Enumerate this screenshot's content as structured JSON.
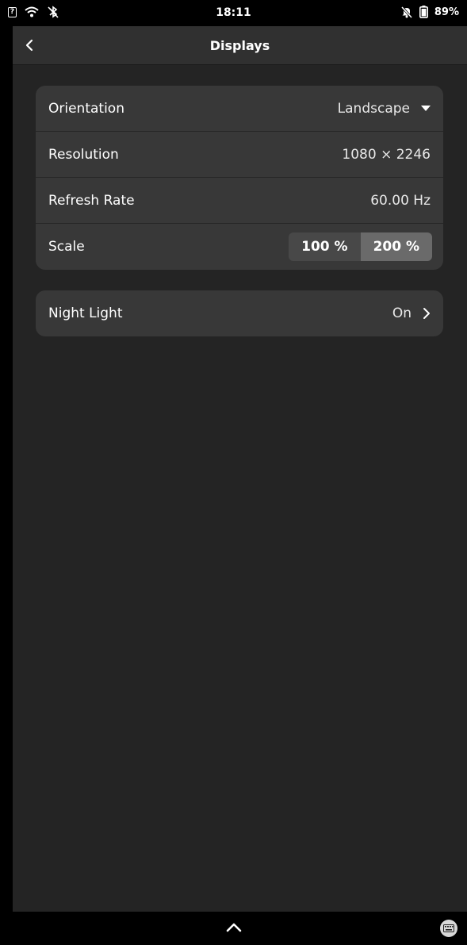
{
  "status_bar": {
    "time": "18:11",
    "battery": "89%",
    "icons": [
      "sim-unknown-icon",
      "wifi-icon",
      "bluetooth-disabled-icon",
      "notifications-muted-icon",
      "battery-icon"
    ]
  },
  "header": {
    "title": "Displays",
    "back_icon": "back-chevron-icon"
  },
  "display_settings": [
    {
      "label": "Orientation",
      "value": "Landscape",
      "control": "dropdown"
    },
    {
      "label": "Resolution",
      "value": "1080 × 2246"
    },
    {
      "label": "Refresh Rate",
      "value": "60.00 Hz"
    },
    {
      "label": "Scale",
      "options": [
        "100 %",
        "200 %"
      ],
      "selected": "200 %"
    }
  ],
  "night_light": {
    "label": "Night Light",
    "value": "On"
  },
  "bottom_bar": {
    "icons": [
      "handle-up-icon",
      "keyboard-icon"
    ]
  },
  "colors": {
    "background": "#242424",
    "card": "#383838",
    "header": "#303030",
    "selected_toggle": "#6a6a6a"
  }
}
